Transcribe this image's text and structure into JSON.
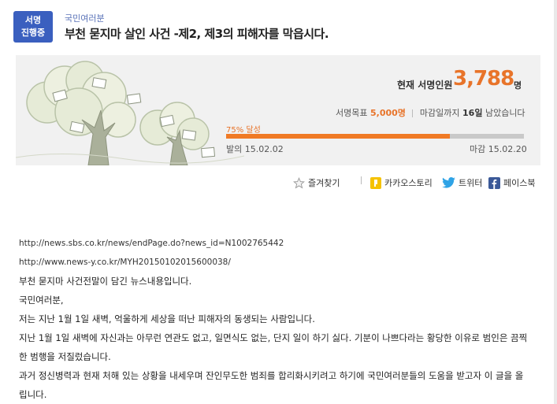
{
  "badge": {
    "line1": "서명",
    "line2": "진행중"
  },
  "category": "국민여러분",
  "title": "부천 묻지마 살인 사건 -제2, 제3의 피해자를 막읍시다.",
  "stats": {
    "current_label": "현재 서명인원",
    "current_count": "3,788",
    "current_unit": "명",
    "goal_label": "서명목표",
    "goal_value": "5,000명",
    "deadline_prefix": "마감일까지",
    "deadline_days": "16일",
    "deadline_suffix": "남았습니다",
    "progress_label": "75% 달성",
    "progress_percent": 75,
    "start_label": "발의",
    "start_date": "15.02.02",
    "end_label": "마감",
    "end_date": "15.02.20"
  },
  "share": {
    "bookmark": "즐겨찾기",
    "kakao": "카카오스토리",
    "twitter": "트위터",
    "facebook": "페이스북"
  },
  "colors": {
    "accent": "#f07a25",
    "badge": "#3a5fbf",
    "twitter": "#2fa3e6",
    "facebook": "#3b5998",
    "kakao": "#f5c200"
  },
  "body": {
    "url1": "http://news.sbs.co.kr/news/endPage.do?news_id=N1002765442",
    "url2": "http://www.news-y.co.kr/MYH20150102015600038/",
    "p1": "부천 묻지마 사건전말이 담긴 뉴스내용입니다.",
    "p2": "국민여러분,",
    "p3": "저는 지난 1월 1일 새벽, 억울하게 세상을 떠난 피해자의 동생되는 사람입니다.",
    "p4": "지난 1월 1일 새벽에 자신과는 아무런 연관도 없고, 일면식도 없는, 단지 일이 하기 싫다. 기분이 나쁘다라는 황당한 이유로 범인은 끔찍한 범행을 저질렀습니다.",
    "p5": "과거 정신병력과 현재 처해 있는 상황을 내세우며 잔인무도한 범죄를 합리화시키려고 하기에 국민여러분들의 도움을 받고자 이 글을 올립니다."
  }
}
